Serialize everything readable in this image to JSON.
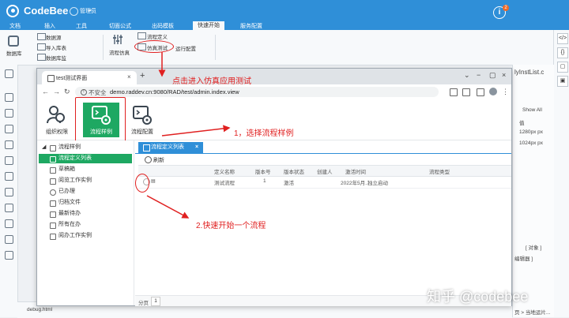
{
  "app": {
    "name": "CodeBee",
    "user_menu": "管理员",
    "notifications": "2"
  },
  "menus": [
    "文档",
    "插入",
    "工具",
    "切面公式",
    "出码模板",
    "快速开始",
    "服务配置"
  ],
  "ribbon": {
    "db_group": "数据库",
    "db_items": [
      "数据源",
      "导入库表",
      "数据库监"
    ],
    "sim_group": "流程仿真",
    "sim_items": [
      "流程定义",
      "仿真测试"
    ],
    "run_config": "运行配置"
  },
  "right_panel": {
    "file_tab": "lyInstList.c",
    "show_all": "Show All",
    "col": "值",
    "val1": "1280px px",
    "val2": "1024px px",
    "obj": "[ 对象 ]",
    "editor": "编辑器 ]",
    "footer": "页 > 当地运片..."
  },
  "footer_file": "debug.html",
  "browser": {
    "tab_title": "test测试界面",
    "url_insecure": "不安全",
    "url": "demo.raddev.cn:9080/RAD/test/admin.index.view"
  },
  "app_toolbar": {
    "org": "组织权限",
    "sample": "流程样例",
    "config": "流程配置"
  },
  "tree": {
    "root": "流程样例",
    "items": [
      "流程定义列表",
      "草稿箱",
      "阅览工作实例",
      "已办理",
      "归档文件",
      "最新待办",
      "所有在办",
      "阅办工作实例"
    ]
  },
  "content": {
    "tab": "流程定义列表",
    "refresh": "刷新",
    "columns": [
      "定义名称",
      "版本号",
      "版本状态",
      "创建人",
      "激活时间",
      "流程类型"
    ],
    "row": {
      "name": "测试流程",
      "version": "1",
      "status": "激活",
      "created": "2022年5月...",
      "type": "独立启动"
    },
    "pager_label": "分页",
    "page": "1"
  },
  "annotations": {
    "top": "点击进入仿真应用测试",
    "step1": "1，选择流程样例",
    "step2": "2.快速开始一个流程"
  },
  "watermark": "知乎 @codebee",
  "colors": {
    "brand": "#2f8fd8",
    "accent_green": "#1ea862",
    "annotation_red": "#e02020"
  }
}
